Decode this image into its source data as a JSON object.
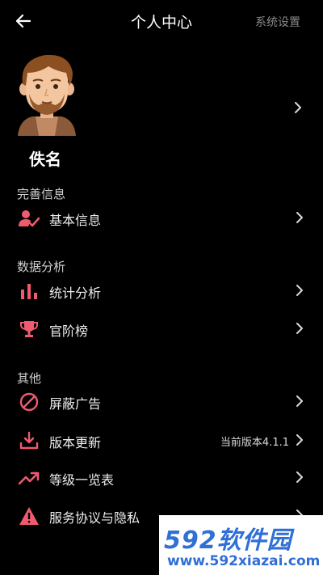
{
  "header": {
    "title": "个人中心",
    "settings_label": "系统设置"
  },
  "profile": {
    "username": "佚名"
  },
  "sections": {
    "info": {
      "title": "完善信息",
      "items": [
        {
          "label": "基本信息",
          "icon": "user-check-icon"
        }
      ]
    },
    "analysis": {
      "title": "数据分析",
      "items": [
        {
          "label": "统计分析",
          "icon": "bar-chart-icon"
        },
        {
          "label": "官阶榜",
          "icon": "trophy-icon"
        }
      ]
    },
    "other": {
      "title": "其他",
      "items": [
        {
          "label": "屏蔽广告",
          "icon": "block-icon"
        },
        {
          "label": "版本更新",
          "icon": "download-icon",
          "extra": "当前版本4.1.1"
        },
        {
          "label": "等级一览表",
          "icon": "trending-up-icon"
        },
        {
          "label": "服务协议与隐私",
          "icon": "warning-icon"
        }
      ]
    }
  },
  "watermark": {
    "brand": "592软件园",
    "url": "www.592xiazai.com"
  },
  "colors": {
    "background": "#000000",
    "accent_icon": "#f05a6e",
    "watermark_blue": "#2f6fd6"
  }
}
